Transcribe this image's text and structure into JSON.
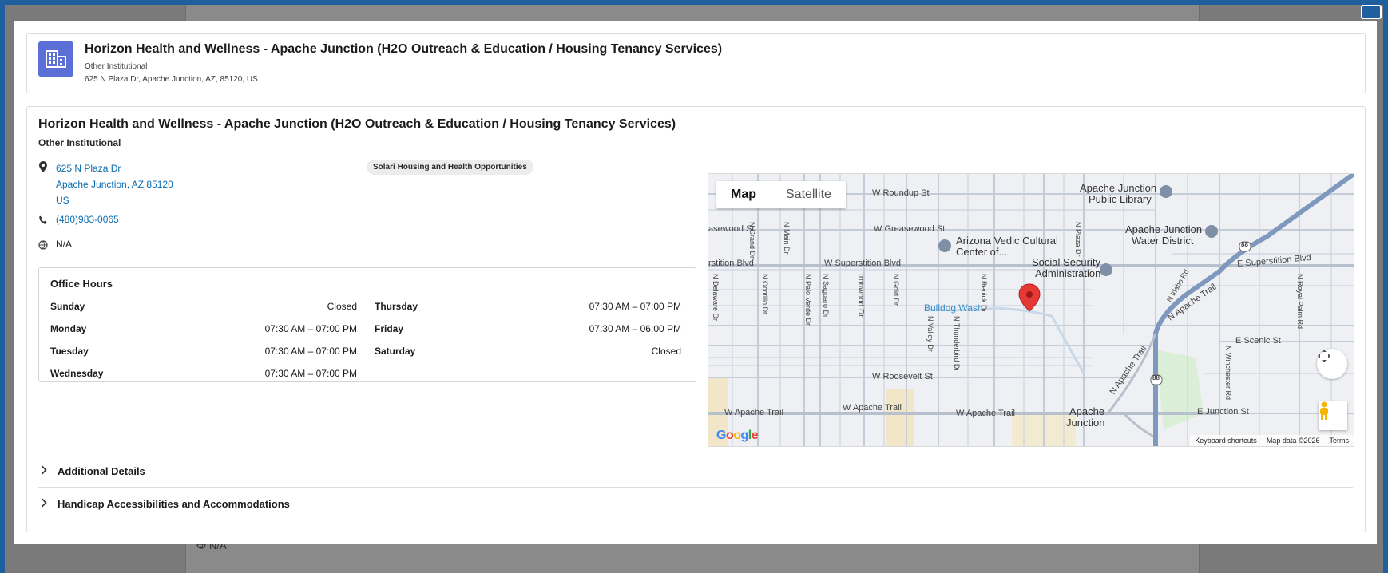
{
  "background": {
    "na_text": "N/A"
  },
  "header": {
    "icon": "building-icon",
    "title": "Horizon Health and Wellness - Apache Junction (H2O Outreach & Education / Housing Tenancy Services)",
    "type": "Other Institutional",
    "address": "625 N Plaza Dr, Apache Junction, AZ, 85120, US"
  },
  "detail": {
    "title": "Horizon Health and Wellness - Apache Junction (H2O Outreach & Education / Housing Tenancy Services)",
    "type": "Other Institutional",
    "address_line1": "625 N Plaza Dr",
    "address_line2": "Apache Junction, AZ 85120",
    "address_line3": "US",
    "phone": "(480)983-0065",
    "website": "N/A",
    "badge": "Solari Housing and Health Opportunities"
  },
  "office_hours": {
    "title": "Office Hours",
    "left": [
      {
        "day": "Sunday",
        "hours": "Closed"
      },
      {
        "day": "Monday",
        "hours": "07:30 AM – 07:00 PM"
      },
      {
        "day": "Tuesday",
        "hours": "07:30 AM – 07:00 PM"
      },
      {
        "day": "Wednesday",
        "hours": "07:30 AM – 07:00 PM"
      }
    ],
    "right": [
      {
        "day": "Thursday",
        "hours": "07:30 AM – 07:00 PM"
      },
      {
        "day": "Friday",
        "hours": "07:30 AM – 06:00 PM"
      },
      {
        "day": "Saturday",
        "hours": "Closed"
      }
    ]
  },
  "map": {
    "tab_map": "Map",
    "tab_satellite": "Satellite",
    "labels": {
      "roundup": "W Roundup St",
      "library1": "Apache Junction",
      "library2": "Public Library",
      "greasewood_w": "asewood St",
      "greasewood": "W Greasewood St",
      "vedic1": "Arizona Vedic Cultural",
      "vedic2": "Center of...",
      "water1": "Apache Junction",
      "water2": "Water District",
      "superstition_w": "rstition Blvd",
      "superstition": "W Superstition Blvd",
      "ssa1": "Social Security",
      "ssa2": "Administration",
      "superstition_e": "E Superstition Blvd",
      "bulldog": "Bulldog Wash",
      "apache_trail_ne": "N Apache Trail",
      "idaho": "N Idaho Rd",
      "scenic": "E Scenic St",
      "roosevelt": "W Roosevelt St",
      "apache_trail_w1": "W Apache Trail",
      "apache_trail_w2": "W Apache Trail",
      "apache_trail_w3": "W Apache Trail",
      "junction1": "Apache",
      "junction2": "Junction",
      "junction_st": "E Junction St",
      "apache_trail_n": "N Apache Trail",
      "delaware": "N Delaware Dr",
      "grand": "N Grand Dr",
      "ocotillo": "N Ocotillo Dr",
      "main": "N Main Dr",
      "palo_verde": "N Palo Verde Dr",
      "saguaro": "N Saguaro Dr",
      "ironwood": "Ironwood Dr",
      "gold": "N Gold Dr",
      "valley": "N Valley Dr",
      "renick": "N Renick Dr",
      "thunderbird": "N Thunderbird Dr",
      "plaza": "N Plaza Dr",
      "winchester": "N Winchester Rd",
      "royal_palm": "N Royal Palm Rd",
      "route1": "88",
      "route2": "88"
    },
    "google": "Google",
    "footer_shortcuts": "Keyboard shortcuts",
    "footer_data": "Map data ©2026",
    "footer_terms": "Terms"
  },
  "sections": {
    "additional": "Additional Details",
    "handicap": "Handicap Accessibilities and Accommodations"
  },
  "colors": {
    "accent": "#5b6fd6",
    "link": "#0b6bb0",
    "pin": "#e53935"
  }
}
